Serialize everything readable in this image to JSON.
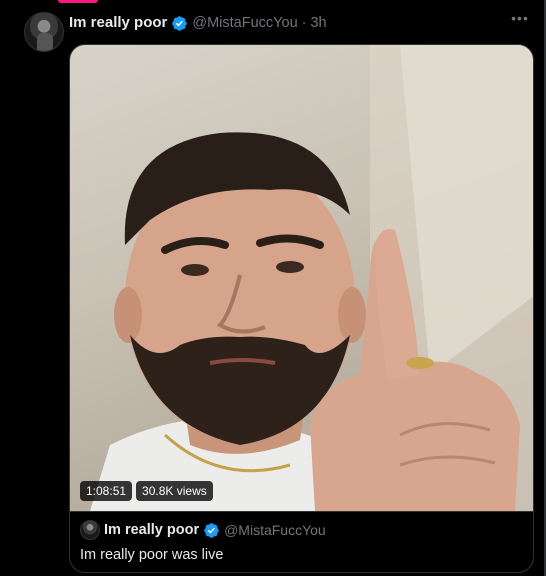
{
  "tweet": {
    "display_name": "Im really poor",
    "handle": "@MistaFuccYou",
    "separator": "·",
    "time": "3h",
    "more_icon": "more-icon"
  },
  "media": {
    "duration": "1:08:51",
    "views": "30.8K views"
  },
  "quote": {
    "display_name": "Im really poor",
    "handle": "@MistaFuccYou",
    "text": "Im really poor was live"
  },
  "colors": {
    "background": "#000000",
    "text": "#e7e9ea",
    "muted": "#71767b",
    "border": "#2f3336",
    "verified": "#1d9bf0",
    "accent_tab": "#f91880"
  }
}
